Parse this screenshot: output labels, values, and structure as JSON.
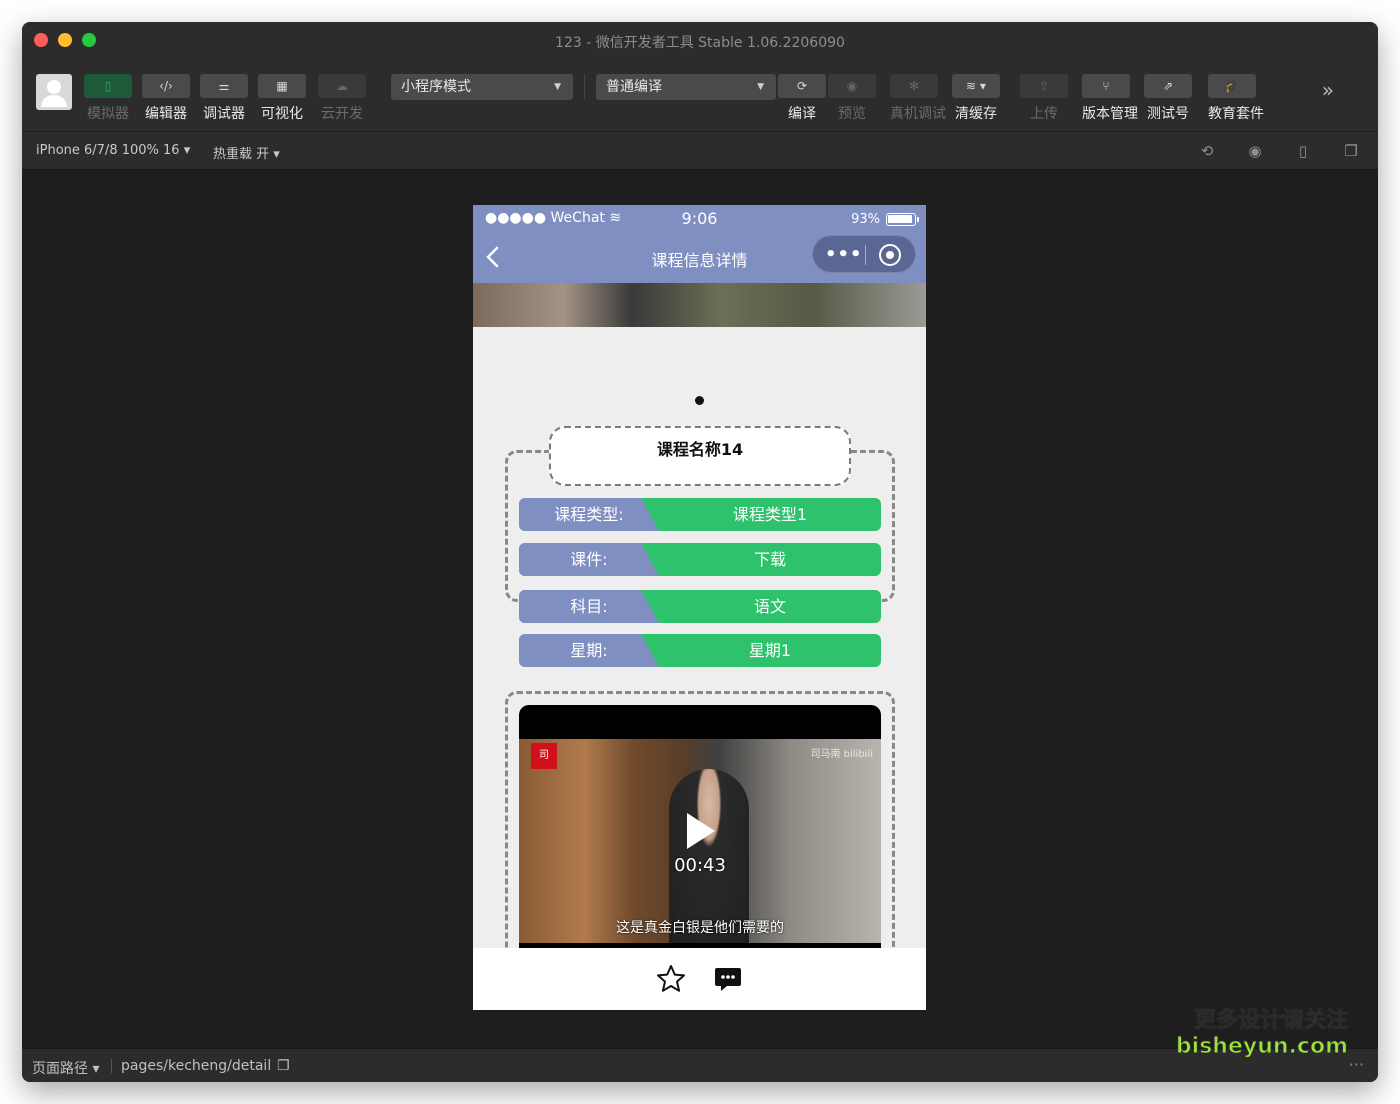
{
  "window": {
    "title": "123 - 微信开发者工具 Stable 1.06.2206090"
  },
  "toolbar": {
    "simulator": "模拟器",
    "editor": "编辑器",
    "debugger": "调试器",
    "visual": "可视化",
    "cloud": "云开发",
    "mode_select": "小程序模式",
    "compile_select": "普通编译",
    "compile": "编译",
    "preview": "预览",
    "device_debug": "真机调试",
    "clear_cache": "清缓存",
    "upload": "上传",
    "version": "版本管理",
    "test_account": "测试号",
    "edu": "教育套件"
  },
  "subbar": {
    "device": "iPhone 6/7/8 100% 16",
    "hot_reload": "热重载 开"
  },
  "statusbar": {
    "path_label": "页面路径",
    "path": "pages/kecheng/detail"
  },
  "phone": {
    "status": {
      "carrier": "●●●●● WeChat",
      "time": "9:06",
      "battery": "93%"
    },
    "nav_title": "课程信息详情",
    "course_name": "课程名称14",
    "rows": [
      {
        "key": "课程类型:",
        "value": "课程类型1"
      },
      {
        "key": "课件:",
        "value": "下载"
      },
      {
        "key": "科目:",
        "value": "语文"
      },
      {
        "key": "星期:",
        "value": "星期1"
      }
    ],
    "video": {
      "duration": "00:43",
      "subtitle": "这是真金白银是他们需要的",
      "logo": "司",
      "brand": "司马南 bilibili"
    }
  },
  "watermark": {
    "line1": "更多设计请关注",
    "line2": "bisheyun.com"
  },
  "colors": {
    "nav": "#7f8fc2",
    "green": "#2ec26d"
  }
}
